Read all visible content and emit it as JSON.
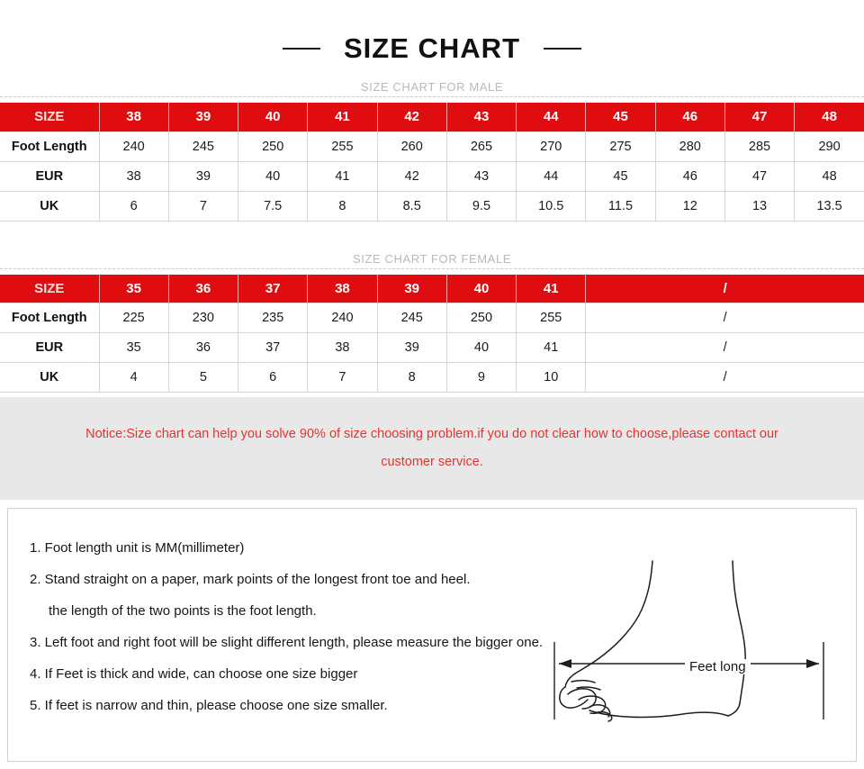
{
  "header": {
    "title": "SIZE CHART",
    "left_dash": "dash",
    "right_dash": "dash"
  },
  "male_section": {
    "subtitle": "SIZE CHART FOR MALE",
    "row_label_header": "SIZE",
    "sizes": [
      "38",
      "39",
      "40",
      "41",
      "42",
      "43",
      "44",
      "45",
      "46",
      "47",
      "48"
    ],
    "rows": [
      {
        "label": "Foot Length",
        "values": [
          "240",
          "245",
          "250",
          "255",
          "260",
          "265",
          "270",
          "275",
          "280",
          "285",
          "290"
        ]
      },
      {
        "label": "EUR",
        "values": [
          "38",
          "39",
          "40",
          "41",
          "42",
          "43",
          "44",
          "45",
          "46",
          "47",
          "48"
        ]
      },
      {
        "label": "UK",
        "values": [
          "6",
          "7",
          "7.5",
          "8",
          "8.5",
          "9.5",
          "10.5",
          "11.5",
          "12",
          "13",
          "13.5"
        ]
      }
    ]
  },
  "female_section": {
    "subtitle": "SIZE CHART FOR FEMALE",
    "row_label_header": "SIZE",
    "sizes": [
      "35",
      "36",
      "37",
      "38",
      "39",
      "40",
      "41"
    ],
    "empty_marker": "/",
    "rows": [
      {
        "label": "Foot Length",
        "values": [
          "225",
          "230",
          "235",
          "240",
          "245",
          "250",
          "255"
        ],
        "merged": "/"
      },
      {
        "label": "EUR",
        "values": [
          "35",
          "36",
          "37",
          "38",
          "39",
          "40",
          "41"
        ],
        "merged": "/"
      },
      {
        "label": "UK",
        "values": [
          "4",
          "5",
          "6",
          "7",
          "8",
          "9",
          "10"
        ],
        "merged": "/"
      }
    ]
  },
  "notice": {
    "line1": "Notice:Size chart can help you solve 90% of size choosing problem.if you do not clear how to choose,please contact our",
    "line2": "customer service."
  },
  "instructions": {
    "lines": [
      {
        "text": "1. Foot length unit is MM(millimeter)",
        "indented": false
      },
      {
        "text": "2. Stand straight on a paper, mark points of the longest front toe and heel.",
        "indented": false
      },
      {
        "text": "the length of the two points is the foot length.",
        "indented": true
      },
      {
        "text": "3. Left foot and right foot will be slight different length, please measure the bigger one.",
        "indented": false
      },
      {
        "text": "4. If Feet is thick and wide, can choose one size bigger",
        "indented": false
      },
      {
        "text": "5. If feet is narrow and thin, please choose one size smaller.",
        "indented": false
      }
    ]
  },
  "diagram": {
    "measure_label": "Feet long",
    "icon": "foot-side-profile-illustration"
  },
  "colors": {
    "brand_red": "#e00d10",
    "notice_red": "#e5332f",
    "notice_bg": "#e8e8e8",
    "subtitle_gray": "#b9b9b9",
    "border_gray": "#d5d5d5"
  }
}
